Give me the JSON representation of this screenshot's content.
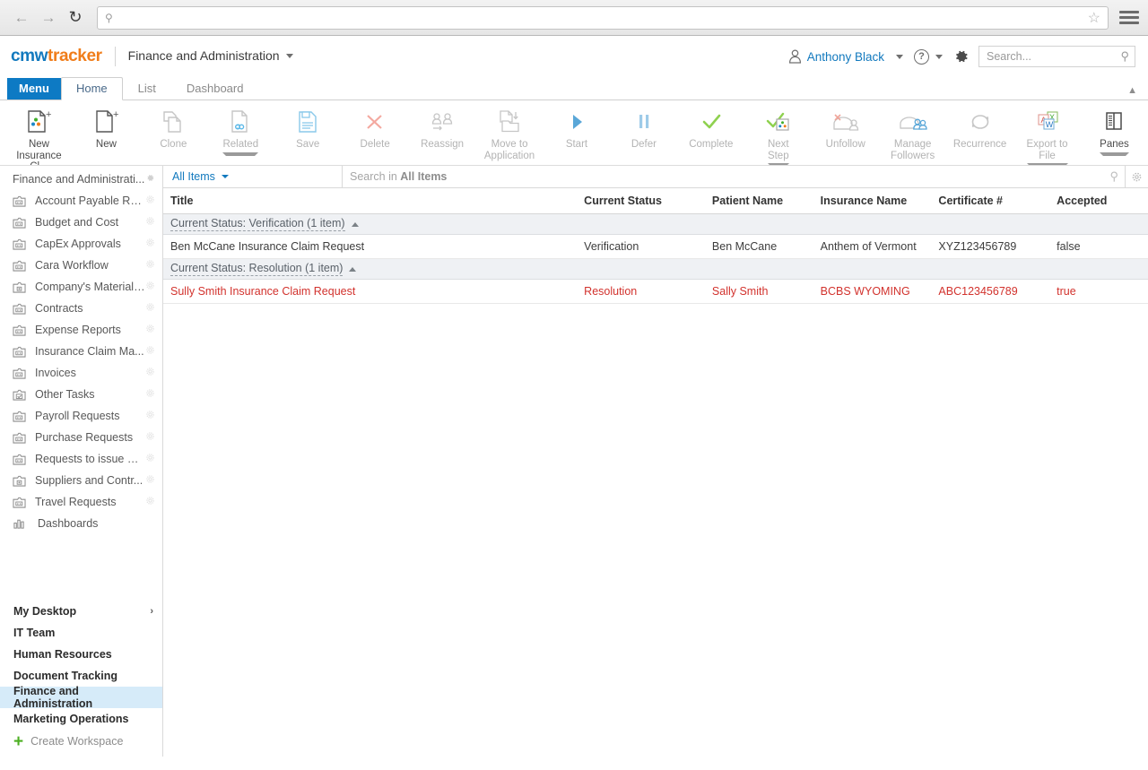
{
  "browser": {
    "back_icon": "back-arrow-icon",
    "forward_icon": "forward-arrow-icon",
    "reload_icon": "reload-icon",
    "url_value": "",
    "url_placeholder": "",
    "star_icon": "bookmark-star-icon",
    "menu_icon": "hamburger-menu-icon"
  },
  "header": {
    "logo_part1": "cmw",
    "logo_part2": "tracker",
    "workspace_title": "Finance and Administration",
    "user_name": "Anthony Black",
    "help_label": "?",
    "search_placeholder": "Search...",
    "accent_blue": "#1279be",
    "accent_orange": "#f07d1a"
  },
  "tabs": {
    "menu_label": "Menu",
    "items": [
      {
        "label": "Home",
        "active": true
      },
      {
        "label": "List",
        "active": false
      },
      {
        "label": "Dashboard",
        "active": false
      }
    ]
  },
  "ribbon": {
    "buttons": [
      {
        "label": "New\nInsurance Cl...",
        "line1": "New",
        "line2": "Insurance Cl...",
        "icon": "new-insurance-claim-icon",
        "enabled": true,
        "caret": false
      },
      {
        "label": "New",
        "line1": "New",
        "line2": "",
        "icon": "new-document-icon",
        "enabled": true,
        "caret": false
      },
      {
        "label": "Clone",
        "line1": "Clone",
        "line2": "",
        "icon": "clone-icon",
        "enabled": false,
        "caret": false
      },
      {
        "label": "Related",
        "line1": "Related",
        "line2": "",
        "icon": "related-link-icon",
        "enabled": false,
        "caret": true
      },
      {
        "label": "Save",
        "line1": "Save",
        "line2": "",
        "icon": "save-floppy-icon",
        "enabled": false,
        "caret": false
      },
      {
        "label": "Delete",
        "line1": "Delete",
        "line2": "",
        "icon": "delete-x-icon",
        "enabled": false,
        "caret": false
      },
      {
        "label": "Reassign",
        "line1": "Reassign",
        "line2": "",
        "icon": "reassign-users-icon",
        "enabled": false,
        "caret": false
      },
      {
        "label": "Move to Application",
        "line1": "Move to",
        "line2": "Application",
        "icon": "move-to-application-icon",
        "enabled": false,
        "caret": false
      },
      {
        "label": "Start",
        "line1": "Start",
        "line2": "",
        "icon": "start-play-icon",
        "enabled": false,
        "caret": false
      },
      {
        "label": "Defer",
        "line1": "Defer",
        "line2": "",
        "icon": "defer-pause-icon",
        "enabled": false,
        "caret": false
      },
      {
        "label": "Complete",
        "line1": "Complete",
        "line2": "",
        "icon": "complete-check-icon",
        "enabled": false,
        "caret": false
      },
      {
        "label": "Next Step",
        "line1": "Next",
        "line2": "Step",
        "icon": "next-step-icon",
        "enabled": false,
        "caret": true
      },
      {
        "label": "Unfollow",
        "line1": "Unfollow",
        "line2": "",
        "icon": "unfollow-icon",
        "enabled": false,
        "caret": false
      },
      {
        "label": "Manage Followers",
        "line1": "Manage",
        "line2": "Followers",
        "icon": "manage-followers-icon",
        "enabled": false,
        "caret": false
      },
      {
        "label": "Recurrence",
        "line1": "Recurrence",
        "line2": "",
        "icon": "recurrence-icon",
        "enabled": false,
        "caret": false
      },
      {
        "label": "Export to File",
        "line1": "Export to",
        "line2": "File",
        "icon": "export-to-file-icon",
        "enabled": false,
        "caret": true
      },
      {
        "label": "Panes",
        "line1": "Panes",
        "line2": "",
        "icon": "panes-icon",
        "enabled": true,
        "caret": true
      }
    ]
  },
  "sidebar": {
    "header_label": "Finance and Administrati...",
    "items": [
      {
        "label": "Account Payable Req...",
        "icon": "app-folder-icon",
        "gear": true
      },
      {
        "label": "Budget and Cost",
        "icon": "app-folder-icon",
        "gear": true
      },
      {
        "label": "CapEx Approvals",
        "icon": "app-folder-icon",
        "gear": true
      },
      {
        "label": "Cara Workflow",
        "icon": "app-folder-icon",
        "gear": true
      },
      {
        "label": "Company's Material ...",
        "icon": "app-folder-alt-icon",
        "gear": true
      },
      {
        "label": "Contracts",
        "icon": "app-folder-icon",
        "gear": true
      },
      {
        "label": "Expense Reports",
        "icon": "app-folder-icon",
        "gear": true
      },
      {
        "label": "Insurance Claim Ma...",
        "icon": "app-folder-icon",
        "gear": true
      },
      {
        "label": "Invoices",
        "icon": "app-folder-icon",
        "gear": true
      },
      {
        "label": "Other Tasks",
        "icon": "app-folder-check-icon",
        "gear": true
      },
      {
        "label": "Payroll Requests",
        "icon": "app-folder-icon",
        "gear": true
      },
      {
        "label": "Purchase Requests",
        "icon": "app-folder-icon",
        "gear": true
      },
      {
        "label": "Requests to issue M...",
        "icon": "app-folder-icon",
        "gear": true
      },
      {
        "label": "Suppliers and Contr...",
        "icon": "app-folder-alt-icon",
        "gear": true
      },
      {
        "label": "Travel Requests",
        "icon": "app-folder-icon",
        "gear": true
      },
      {
        "label": "Dashboards",
        "icon": "bar-chart-icon",
        "gear": false
      }
    ],
    "workspaces": [
      {
        "label": "My Desktop",
        "selected": false,
        "arrow": true
      },
      {
        "label": "IT Team",
        "selected": false,
        "arrow": false
      },
      {
        "label": "Human Resources",
        "selected": false,
        "arrow": false
      },
      {
        "label": "Document Tracking",
        "selected": false,
        "arrow": false
      },
      {
        "label": "Finance and Administration",
        "selected": true,
        "arrow": false
      },
      {
        "label": "Marketing Operations",
        "selected": false,
        "arrow": false
      }
    ],
    "create_workspace_label": "Create Workspace",
    "selected_bg": "#d6ebf9"
  },
  "list_toolbar": {
    "view_name": "All Items",
    "search_prefix": "Search in ",
    "search_target": "All Items",
    "search_icon": "search-icon",
    "settings_icon": "gear-icon"
  },
  "grid": {
    "columns": [
      "Title",
      "Current Status",
      "Patient Name",
      "Insurance Name",
      "Certificate #",
      "Accepted"
    ],
    "groups": [
      {
        "header": "Current Status: Verification (1 item)",
        "collapsed": false,
        "rows": [
          {
            "cells": [
              "Ben McCane Insurance Claim Request",
              "Verification",
              "Ben McCane",
              "Anthem of Vermont",
              "XYZ123456789",
              "false"
            ],
            "highlight": false
          }
        ]
      },
      {
        "header": "Current Status: Resolution (1 item)",
        "collapsed": false,
        "rows": [
          {
            "cells": [
              "Sully Smith Insurance Claim Request",
              "Resolution",
              "Sally Smith",
              "BCBS WYOMING",
              "ABC123456789",
              "true"
            ],
            "highlight": true
          }
        ]
      }
    ],
    "highlight_color": "#d2322d"
  }
}
